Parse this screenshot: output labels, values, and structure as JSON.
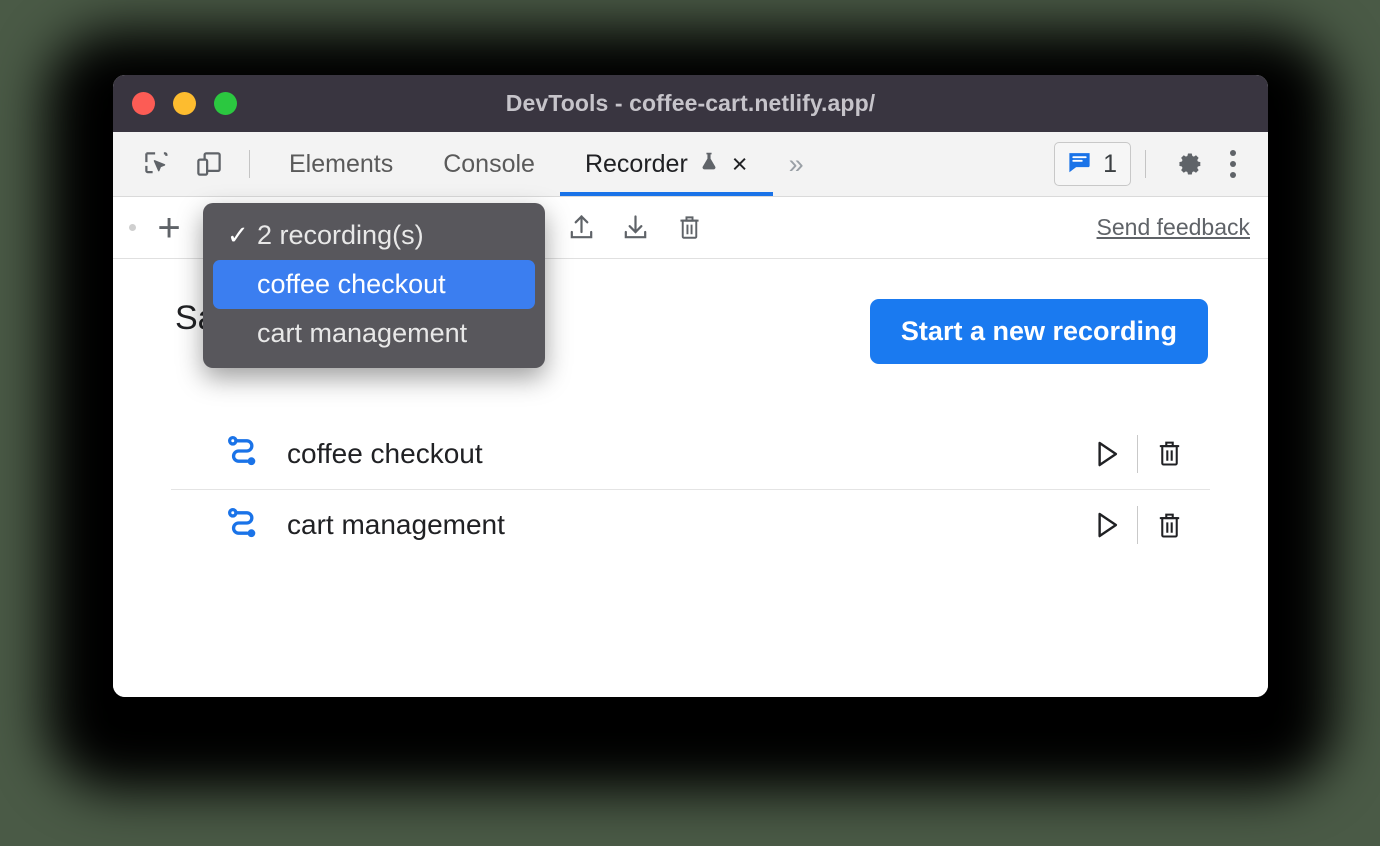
{
  "window": {
    "title": "DevTools - coffee-cart.netlify.app/",
    "traffic_lights": [
      "close",
      "minimize",
      "maximize"
    ],
    "colors": {
      "titlebar_bg": "#393540",
      "accent_blue": "#1a73e8",
      "start_button_blue": "#1a7af0",
      "dropdown_bg": "#58575c",
      "dropdown_selected": "#3b7ef0",
      "page_bg": "#4a5a46",
      "recording_icon_blue": "#1a73e8"
    }
  },
  "tabbar": {
    "left_icons": [
      {
        "name": "inspect-element-icon",
        "label": "Inspect element"
      },
      {
        "name": "device-toolbar-icon",
        "label": "Toggle device toolbar"
      }
    ],
    "tabs": [
      {
        "label": "Elements",
        "active": false
      },
      {
        "label": "Console",
        "active": false
      },
      {
        "label": "Recorder",
        "active": true,
        "experimental": true,
        "closable": true
      }
    ],
    "close_label": "×",
    "overflow_label": "»",
    "issues": {
      "count": "1",
      "icon": "issues-icon"
    },
    "settings_label": "Settings",
    "more_label": "Customize and control DevTools"
  },
  "recorder_toolbar": {
    "add_label": "+",
    "selector_value": "2 recording(s)",
    "export_label": "Export recording",
    "import_label": "Import recording",
    "delete_label": "Delete recording",
    "feedback_label": "Send feedback"
  },
  "panel": {
    "heading": "Saved recordings",
    "start_button": "Start a new recording",
    "recordings": [
      {
        "name": "coffee checkout",
        "play_label": "Replay",
        "delete_label": "Delete"
      },
      {
        "name": "cart management",
        "play_label": "Replay",
        "delete_label": "Delete"
      }
    ]
  },
  "dropdown": {
    "open": true,
    "header": {
      "label": "2 recording(s)",
      "checked": true,
      "check_glyph": "✓"
    },
    "items": [
      {
        "label": "coffee checkout",
        "selected": true
      },
      {
        "label": "cart management",
        "selected": false
      }
    ]
  }
}
